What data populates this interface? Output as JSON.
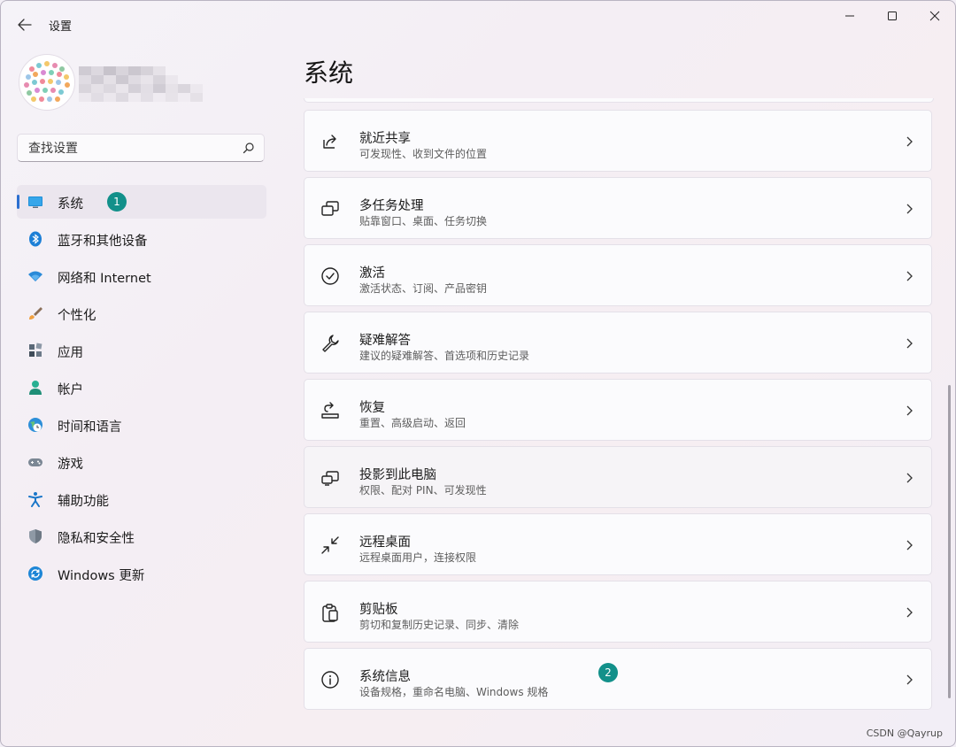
{
  "titlebar": {
    "title": "设置",
    "back_icon": "arrow-left-icon",
    "minimize_icon": "minimize-icon",
    "maximize_icon": "maximize-icon",
    "close_icon": "close-icon"
  },
  "search": {
    "placeholder": "查找设置",
    "icon": "search-icon"
  },
  "sidebar": {
    "items": [
      {
        "label": "系统",
        "icon": "monitor-icon",
        "active": true,
        "badge": "1"
      },
      {
        "label": "蓝牙和其他设备",
        "icon": "bluetooth-icon"
      },
      {
        "label": "网络和 Internet",
        "icon": "wifi-icon"
      },
      {
        "label": "个性化",
        "icon": "brush-icon"
      },
      {
        "label": "应用",
        "icon": "apps-icon"
      },
      {
        "label": "帐户",
        "icon": "person-icon"
      },
      {
        "label": "时间和语言",
        "icon": "globe-clock-icon"
      },
      {
        "label": "游戏",
        "icon": "gamepad-icon"
      },
      {
        "label": "辅助功能",
        "icon": "accessibility-icon"
      },
      {
        "label": "隐私和安全性",
        "icon": "shield-icon"
      },
      {
        "label": "Windows 更新",
        "icon": "update-icon"
      }
    ]
  },
  "main": {
    "title": "系统",
    "cards": [
      {
        "title": "就近共享",
        "subtitle": "可发现性、收到文件的位置",
        "icon": "share-icon"
      },
      {
        "title": "多任务处理",
        "subtitle": "贴靠窗口、桌面、任务切换",
        "icon": "multitask-icon"
      },
      {
        "title": "激活",
        "subtitle": "激活状态、订阅、产品密钥",
        "icon": "check-circle-icon"
      },
      {
        "title": "疑难解答",
        "subtitle": "建议的疑难解答、首选项和历史记录",
        "icon": "wrench-icon"
      },
      {
        "title": "恢复",
        "subtitle": "重置、高级启动、返回",
        "icon": "recovery-icon"
      },
      {
        "title": "投影到此电脑",
        "subtitle": "权限、配对 PIN、可发现性",
        "icon": "project-icon"
      },
      {
        "title": "远程桌面",
        "subtitle": "远程桌面用户，连接权限",
        "icon": "remote-desktop-icon"
      },
      {
        "title": "剪贴板",
        "subtitle": "剪切和复制历史记录、同步、清除",
        "icon": "clipboard-icon"
      },
      {
        "title": "系统信息",
        "subtitle": "设备规格，重命名电脑、Windows 规格",
        "icon": "info-icon",
        "badge": "2"
      }
    ]
  },
  "watermark": "CSDN @Qayrup",
  "colors": {
    "accent": "#2c6fd0",
    "badge": "#12908a"
  }
}
